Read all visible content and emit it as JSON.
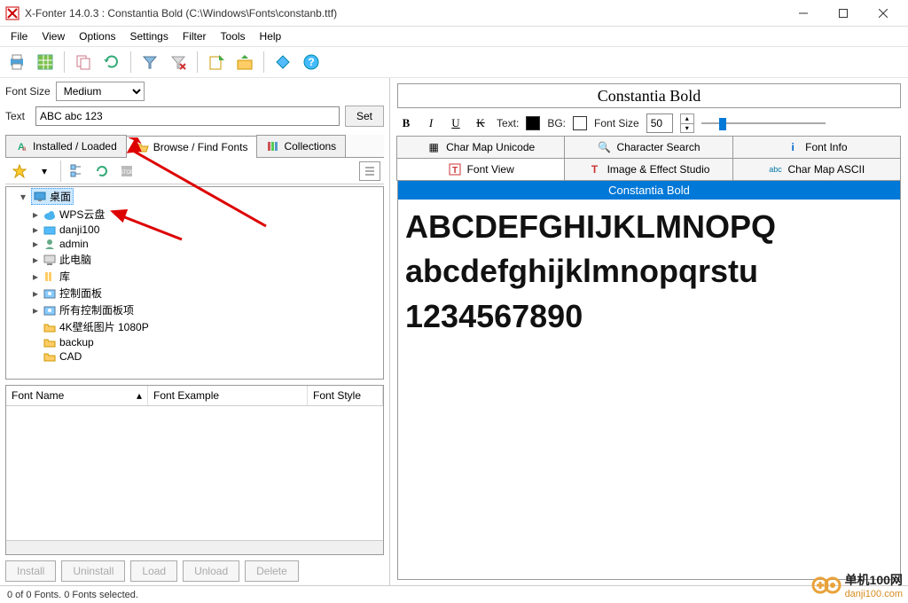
{
  "titlebar": {
    "title": "X-Fonter 14.0.3  :  Constantia Bold (C:\\Windows\\Fonts\\constanb.ttf)"
  },
  "menu": {
    "file": "File",
    "view": "View",
    "options": "Options",
    "settings": "Settings",
    "filter": "Filter",
    "tools": "Tools",
    "help": "Help"
  },
  "left": {
    "fontsize_label": "Font Size",
    "fontsize_value": "Medium",
    "text_label": "Text",
    "text_value": "ABC abc 123",
    "set_btn": "Set",
    "tabs": {
      "installed": "Installed / Loaded",
      "browse": "Browse / Find Fonts",
      "collections": "Collections"
    },
    "tree": [
      {
        "label": "桌面",
        "sel": true,
        "exp": "-",
        "icon": "desktop"
      },
      {
        "label": "WPS云盘",
        "exp": ">",
        "icon": "cloud"
      },
      {
        "label": "danji100",
        "exp": ">",
        "icon": "folder-blue"
      },
      {
        "label": "admin",
        "exp": ">",
        "icon": "user"
      },
      {
        "label": "此电脑",
        "exp": ">",
        "icon": "pc"
      },
      {
        "label": "库",
        "exp": ">",
        "icon": "lib"
      },
      {
        "label": "控制面板",
        "exp": ">",
        "icon": "cp"
      },
      {
        "label": "所有控制面板项",
        "exp": ">",
        "icon": "cp"
      },
      {
        "label": "4K壁纸图片 1080P",
        "exp": " ",
        "icon": "folder"
      },
      {
        "label": "backup",
        "exp": " ",
        "icon": "folder"
      },
      {
        "label": "CAD",
        "exp": " ",
        "icon": "folder"
      }
    ],
    "list_cols": {
      "name": "Font Name",
      "example": "Font Example",
      "style": "Font Style"
    },
    "buttons": {
      "install": "Install",
      "uninstall": "Uninstall",
      "load": "Load",
      "unload": "Unload",
      "delete": "Delete"
    }
  },
  "right": {
    "title": "Constantia Bold",
    "text_lbl": "Text:",
    "bg_lbl": "BG:",
    "fontsize_lbl": "Font Size",
    "fontsize_val": "50",
    "tabs": {
      "charmap_u": "Char Map Unicode",
      "charsearch": "Character Search",
      "fontinfo": "Font Info",
      "fontview": "Font View",
      "imagestudio": "Image & Effect Studio",
      "charmap_a": "Char Map ASCII"
    },
    "preview_title": "Constantia Bold",
    "preview_lines": [
      "ABCDEFGHIJKLMNOPQ",
      "abcdefghijklmnopqrstu",
      "1234567890"
    ]
  },
  "status": "0 of 0 Fonts.   0 Fonts selected.",
  "watermark": {
    "big": "单机100网",
    "small": "danji100.com"
  }
}
